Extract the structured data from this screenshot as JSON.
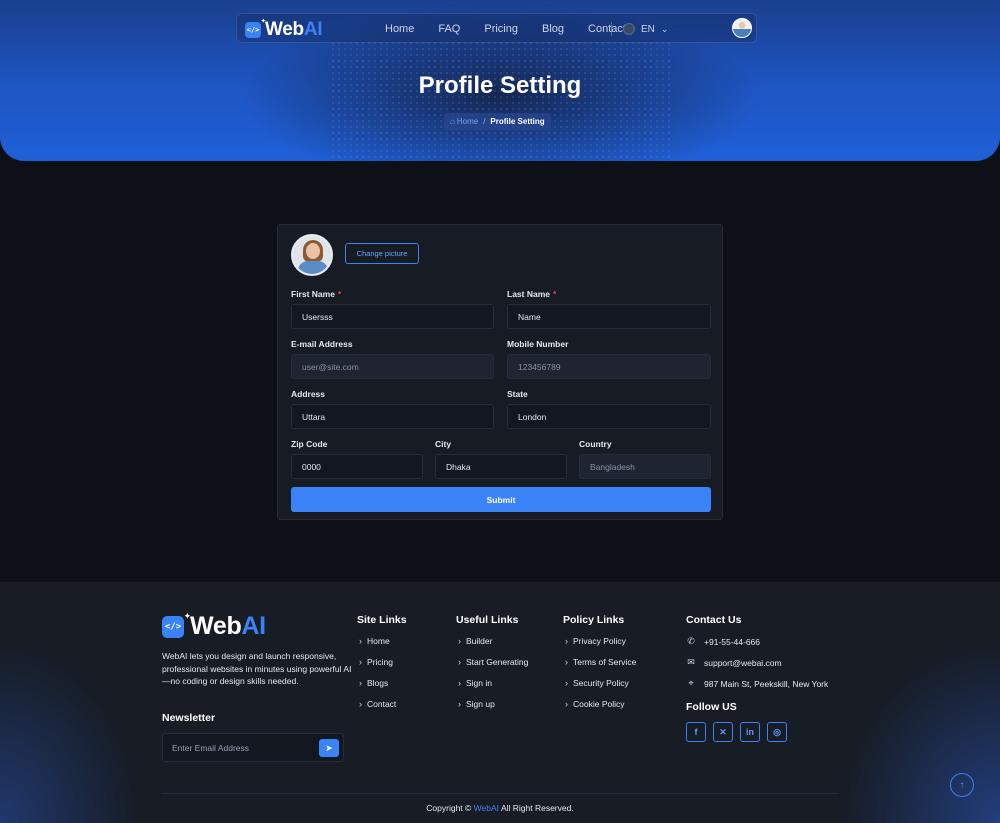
{
  "nav": {
    "brand_web": "Web",
    "brand_ai": "AI",
    "links": [
      "Home",
      "FAQ",
      "Pricing",
      "Blog",
      "Contact"
    ],
    "language": "EN"
  },
  "hero": {
    "title": "Profile Setting",
    "breadcrumb": {
      "home": "Home",
      "separator": "/",
      "current": "Profile Setting"
    }
  },
  "form": {
    "change_picture": "Change picture",
    "first_name": {
      "label": "First Name",
      "required": "*",
      "value": "Usersss"
    },
    "last_name": {
      "label": "Last Name",
      "required": "*",
      "value": "Name"
    },
    "email": {
      "label": "E-mail Address",
      "value": "user@site.com"
    },
    "mobile": {
      "label": "Mobile Number",
      "value": "123456789"
    },
    "address": {
      "label": "Address",
      "value": "Uttara"
    },
    "state": {
      "label": "State",
      "value": "London"
    },
    "zip": {
      "label": "Zip Code",
      "value": "0000"
    },
    "city": {
      "label": "City",
      "value": "Dhaka"
    },
    "country": {
      "label": "Country",
      "value": "Bangladesh"
    },
    "submit": "Submit"
  },
  "footer": {
    "brand_web": "Web",
    "brand_ai": "AI",
    "about": "WebAI lets you design and launch responsive, professional websites in minutes using powerful AI—no coding or design skills needed.",
    "newsletter_title": "Newsletter",
    "newsletter_placeholder": "Enter Email Address",
    "site_links": {
      "title": "Site Links",
      "items": [
        "Home",
        "Pricing",
        "Blogs",
        "Contact"
      ]
    },
    "useful_links": {
      "title": "Useful Links",
      "items": [
        "Builder",
        "Start Generating",
        "Sign in",
        "Sign up"
      ]
    },
    "policy_links": {
      "title": "Policy Links",
      "items": [
        "Privacy Policy",
        "Terms of Service",
        "Security Policy",
        "Cookie Policy"
      ]
    },
    "contact": {
      "title": "Contact Us",
      "phone": "+91-55-44-666",
      "email": "support@webai.com",
      "address": "987 Main St, Peekskill, New York"
    },
    "follow_title": "Follow US",
    "copyright_prefix": "Copyright ©",
    "copyright_brand": "WebAI",
    "copyright_suffix": "All Right Reserved."
  },
  "colors": {
    "accent": "#3b82f6",
    "background": "#0d1117",
    "card": "#161b24",
    "required": "#ef4444"
  }
}
